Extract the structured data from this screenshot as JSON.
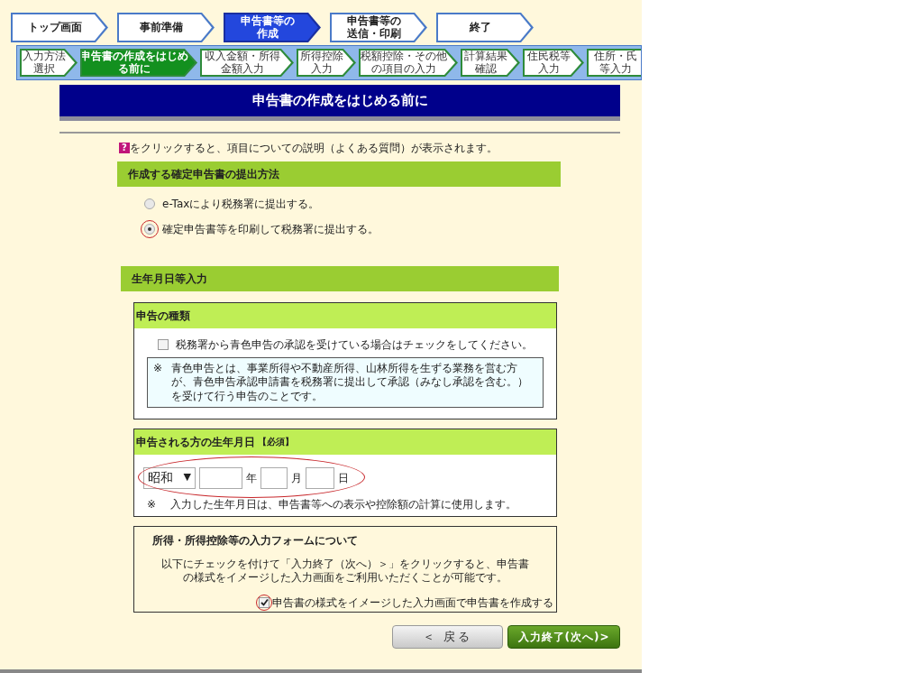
{
  "top_steps": [
    {
      "lines": [
        "トップ画面"
      ],
      "selected": false
    },
    {
      "lines": [
        "事前準備"
      ],
      "selected": false
    },
    {
      "lines": [
        "申告書等の",
        "作成"
      ],
      "selected": true
    },
    {
      "lines": [
        "申告書等の",
        "送信・印刷"
      ],
      "selected": false
    },
    {
      "lines": [
        "終了"
      ],
      "selected": false
    }
  ],
  "sub_steps": [
    {
      "lines": [
        "入力方法",
        "選択"
      ],
      "selected": false
    },
    {
      "lines": [
        "申告書の作成をはじめ",
        "る前に"
      ],
      "selected": true
    },
    {
      "lines": [
        "収入金額・所得",
        "金額入力"
      ],
      "selected": false
    },
    {
      "lines": [
        "所得控除",
        "入力"
      ],
      "selected": false
    },
    {
      "lines": [
        "税額控除・その他",
        "の項目の入力"
      ],
      "selected": false
    },
    {
      "lines": [
        "計算結果",
        "確認"
      ],
      "selected": false
    },
    {
      "lines": [
        "住民税等",
        "入力"
      ],
      "selected": false
    },
    {
      "lines": [
        "住所・氏",
        "等入力"
      ],
      "selected": false
    }
  ],
  "page_title": "申告書の作成をはじめる前に",
  "help_icon": "?",
  "help_text": "をクリックすると、項目についての説明（よくある質問）が表示されます。",
  "submission": {
    "heading": "作成する確定申告書の提出方法",
    "options": [
      {
        "label": "e-Taxにより税務署に提出する。",
        "selected": false,
        "circled": false
      },
      {
        "label": "確定申告書等を印刷して税務署に提出する。",
        "selected": true,
        "circled": true
      }
    ]
  },
  "birth_section": {
    "heading": "生年月日等入力",
    "return_type": {
      "heading": "申告の種類",
      "checkbox": {
        "label": "税務署から青色申告の承認を受けている場合はチェックをしてください。",
        "checked": false
      },
      "note_mark": "※",
      "note": "青色申告とは、事業所得や不動産所得、山林所得を生ずる業務を営む方が、青色申告承認申請書を税務署に提出して承認（みなし承認を含む。）を受けて行う申告のことです。"
    },
    "birthdate": {
      "heading": "申告される方の生年月日",
      "required_tag": "【必須】",
      "era": "昭和",
      "caret": "▼",
      "year_unit": "年",
      "month_unit": "月",
      "day_unit": "日",
      "circled": true,
      "note_mark": "※",
      "note": "入力した生年月日は、申告書等への表示や控除額の計算に使用します。"
    },
    "form_info": {
      "heading": "所得・所得控除等の入力フォームについて",
      "text": "以下にチェックを付けて「入力終了（次へ）＞」をクリックすると、申告書の様式をイメージした入力画面をご利用いただくことが可能です。",
      "checkbox": {
        "label": "申告書の様式をイメージした入力画面で申告書を作成する",
        "checked": true,
        "circled": true
      }
    }
  },
  "buttons": [
    {
      "kind": "back",
      "label": "＜ 戻る"
    },
    {
      "kind": "next",
      "label": "入力終了(次へ)>"
    }
  ]
}
